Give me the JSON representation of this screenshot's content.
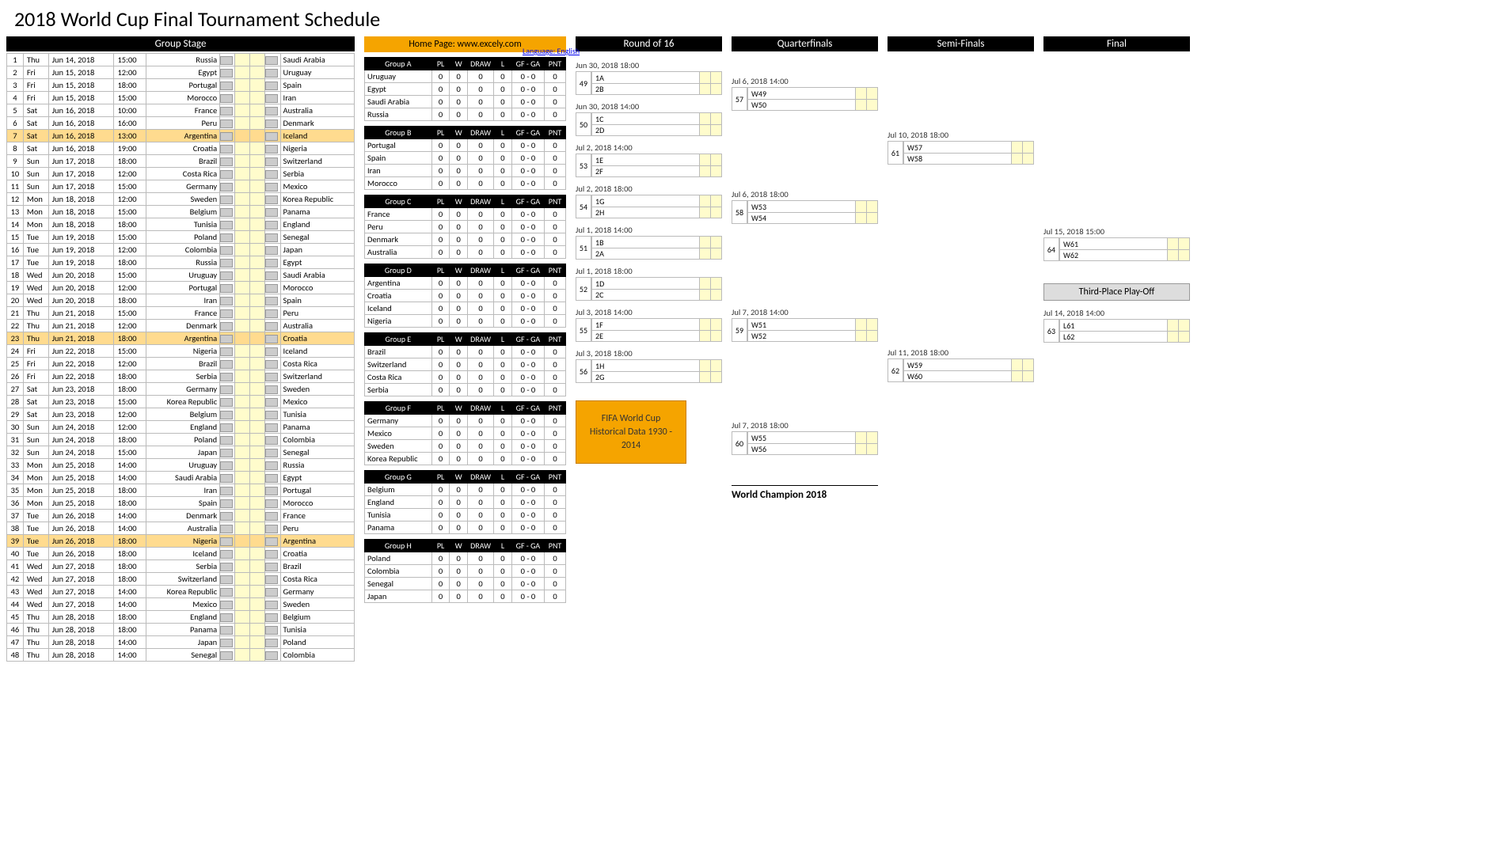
{
  "title": "2018 World Cup Final Tournament Schedule",
  "lang": "Language: English",
  "home": "Home Page: www.excely.com",
  "headers": {
    "group_stage": "Group Stage",
    "r16": "Round of 16",
    "qf": "Quarterfinals",
    "sf": "Semi-Finals",
    "final": "Final",
    "third": "Third-Place Play-Off",
    "champion": "World Champion 2018"
  },
  "gcols": {
    "pl": "PL",
    "w": "W",
    "draw": "DRAW",
    "l": "L",
    "gfga": "GF - GA",
    "pnt": "PNT"
  },
  "sched": [
    {
      "n": 1,
      "d": "Thu",
      "dt": "Jun 14, 2018",
      "t": "15:00",
      "h": "Russia",
      "a": "Saudi Arabia"
    },
    {
      "n": 2,
      "d": "Fri",
      "dt": "Jun 15, 2018",
      "t": "12:00",
      "h": "Egypt",
      "a": "Uruguay"
    },
    {
      "n": 3,
      "d": "Fri",
      "dt": "Jun 15, 2018",
      "t": "18:00",
      "h": "Portugal",
      "a": "Spain"
    },
    {
      "n": 4,
      "d": "Fri",
      "dt": "Jun 15, 2018",
      "t": "15:00",
      "h": "Morocco",
      "a": "Iran"
    },
    {
      "n": 5,
      "d": "Sat",
      "dt": "Jun 16, 2018",
      "t": "10:00",
      "h": "France",
      "a": "Australia"
    },
    {
      "n": 6,
      "d": "Sat",
      "dt": "Jun 16, 2018",
      "t": "16:00",
      "h": "Peru",
      "a": "Denmark"
    },
    {
      "n": 7,
      "d": "Sat",
      "dt": "Jun 16, 2018",
      "t": "13:00",
      "h": "Argentina",
      "a": "Iceland",
      "hl": true
    },
    {
      "n": 8,
      "d": "Sat",
      "dt": "Jun 16, 2018",
      "t": "19:00",
      "h": "Croatia",
      "a": "Nigeria"
    },
    {
      "n": 9,
      "d": "Sun",
      "dt": "Jun 17, 2018",
      "t": "18:00",
      "h": "Brazil",
      "a": "Switzerland"
    },
    {
      "n": 10,
      "d": "Sun",
      "dt": "Jun 17, 2018",
      "t": "12:00",
      "h": "Costa Rica",
      "a": "Serbia"
    },
    {
      "n": 11,
      "d": "Sun",
      "dt": "Jun 17, 2018",
      "t": "15:00",
      "h": "Germany",
      "a": "Mexico"
    },
    {
      "n": 12,
      "d": "Mon",
      "dt": "Jun 18, 2018",
      "t": "12:00",
      "h": "Sweden",
      "a": "Korea Republic"
    },
    {
      "n": 13,
      "d": "Mon",
      "dt": "Jun 18, 2018",
      "t": "15:00",
      "h": "Belgium",
      "a": "Panama"
    },
    {
      "n": 14,
      "d": "Mon",
      "dt": "Jun 18, 2018",
      "t": "18:00",
      "h": "Tunisia",
      "a": "England"
    },
    {
      "n": 15,
      "d": "Tue",
      "dt": "Jun 19, 2018",
      "t": "15:00",
      "h": "Poland",
      "a": "Senegal"
    },
    {
      "n": 16,
      "d": "Tue",
      "dt": "Jun 19, 2018",
      "t": "12:00",
      "h": "Colombia",
      "a": "Japan"
    },
    {
      "n": 17,
      "d": "Tue",
      "dt": "Jun 19, 2018",
      "t": "18:00",
      "h": "Russia",
      "a": "Egypt"
    },
    {
      "n": 18,
      "d": "Wed",
      "dt": "Jun 20, 2018",
      "t": "15:00",
      "h": "Uruguay",
      "a": "Saudi Arabia"
    },
    {
      "n": 19,
      "d": "Wed",
      "dt": "Jun 20, 2018",
      "t": "12:00",
      "h": "Portugal",
      "a": "Morocco"
    },
    {
      "n": 20,
      "d": "Wed",
      "dt": "Jun 20, 2018",
      "t": "18:00",
      "h": "Iran",
      "a": "Spain"
    },
    {
      "n": 21,
      "d": "Thu",
      "dt": "Jun 21, 2018",
      "t": "15:00",
      "h": "France",
      "a": "Peru"
    },
    {
      "n": 22,
      "d": "Thu",
      "dt": "Jun 21, 2018",
      "t": "12:00",
      "h": "Denmark",
      "a": "Australia"
    },
    {
      "n": 23,
      "d": "Thu",
      "dt": "Jun 21, 2018",
      "t": "18:00",
      "h": "Argentina",
      "a": "Croatia",
      "hl": true
    },
    {
      "n": 24,
      "d": "Fri",
      "dt": "Jun 22, 2018",
      "t": "15:00",
      "h": "Nigeria",
      "a": "Iceland"
    },
    {
      "n": 25,
      "d": "Fri",
      "dt": "Jun 22, 2018",
      "t": "12:00",
      "h": "Brazil",
      "a": "Costa Rica"
    },
    {
      "n": 26,
      "d": "Fri",
      "dt": "Jun 22, 2018",
      "t": "18:00",
      "h": "Serbia",
      "a": "Switzerland"
    },
    {
      "n": 27,
      "d": "Sat",
      "dt": "Jun 23, 2018",
      "t": "18:00",
      "h": "Germany",
      "a": "Sweden"
    },
    {
      "n": 28,
      "d": "Sat",
      "dt": "Jun 23, 2018",
      "t": "15:00",
      "h": "Korea Republic",
      "a": "Mexico"
    },
    {
      "n": 29,
      "d": "Sat",
      "dt": "Jun 23, 2018",
      "t": "12:00",
      "h": "Belgium",
      "a": "Tunisia"
    },
    {
      "n": 30,
      "d": "Sun",
      "dt": "Jun 24, 2018",
      "t": "12:00",
      "h": "England",
      "a": "Panama"
    },
    {
      "n": 31,
      "d": "Sun",
      "dt": "Jun 24, 2018",
      "t": "18:00",
      "h": "Poland",
      "a": "Colombia"
    },
    {
      "n": 32,
      "d": "Sun",
      "dt": "Jun 24, 2018",
      "t": "15:00",
      "h": "Japan",
      "a": "Senegal"
    },
    {
      "n": 33,
      "d": "Mon",
      "dt": "Jun 25, 2018",
      "t": "14:00",
      "h": "Uruguay",
      "a": "Russia"
    },
    {
      "n": 34,
      "d": "Mon",
      "dt": "Jun 25, 2018",
      "t": "14:00",
      "h": "Saudi Arabia",
      "a": "Egypt"
    },
    {
      "n": 35,
      "d": "Mon",
      "dt": "Jun 25, 2018",
      "t": "18:00",
      "h": "Iran",
      "a": "Portugal"
    },
    {
      "n": 36,
      "d": "Mon",
      "dt": "Jun 25, 2018",
      "t": "18:00",
      "h": "Spain",
      "a": "Morocco"
    },
    {
      "n": 37,
      "d": "Tue",
      "dt": "Jun 26, 2018",
      "t": "14:00",
      "h": "Denmark",
      "a": "France"
    },
    {
      "n": 38,
      "d": "Tue",
      "dt": "Jun 26, 2018",
      "t": "14:00",
      "h": "Australia",
      "a": "Peru"
    },
    {
      "n": 39,
      "d": "Tue",
      "dt": "Jun 26, 2018",
      "t": "18:00",
      "h": "Nigeria",
      "a": "Argentina",
      "hl": true
    },
    {
      "n": 40,
      "d": "Tue",
      "dt": "Jun 26, 2018",
      "t": "18:00",
      "h": "Iceland",
      "a": "Croatia"
    },
    {
      "n": 41,
      "d": "Wed",
      "dt": "Jun 27, 2018",
      "t": "18:00",
      "h": "Serbia",
      "a": "Brazil"
    },
    {
      "n": 42,
      "d": "Wed",
      "dt": "Jun 27, 2018",
      "t": "18:00",
      "h": "Switzerland",
      "a": "Costa Rica"
    },
    {
      "n": 43,
      "d": "Wed",
      "dt": "Jun 27, 2018",
      "t": "14:00",
      "h": "Korea Republic",
      "a": "Germany"
    },
    {
      "n": 44,
      "d": "Wed",
      "dt": "Jun 27, 2018",
      "t": "14:00",
      "h": "Mexico",
      "a": "Sweden"
    },
    {
      "n": 45,
      "d": "Thu",
      "dt": "Jun 28, 2018",
      "t": "18:00",
      "h": "England",
      "a": "Belgium"
    },
    {
      "n": 46,
      "d": "Thu",
      "dt": "Jun 28, 2018",
      "t": "18:00",
      "h": "Panama",
      "a": "Tunisia"
    },
    {
      "n": 47,
      "d": "Thu",
      "dt": "Jun 28, 2018",
      "t": "14:00",
      "h": "Japan",
      "a": "Poland"
    },
    {
      "n": 48,
      "d": "Thu",
      "dt": "Jun 28, 2018",
      "t": "14:00",
      "h": "Senegal",
      "a": "Colombia"
    }
  ],
  "groups": [
    {
      "name": "Group A",
      "teams": [
        "Uruguay",
        "Egypt",
        "Saudi Arabia",
        "Russia"
      ]
    },
    {
      "name": "Group B",
      "teams": [
        "Portugal",
        "Spain",
        "Iran",
        "Morocco"
      ]
    },
    {
      "name": "Group C",
      "teams": [
        "France",
        "Peru",
        "Denmark",
        "Australia"
      ]
    },
    {
      "name": "Group D",
      "teams": [
        "Argentina",
        "Croatia",
        "Iceland",
        "Nigeria"
      ]
    },
    {
      "name": "Group E",
      "teams": [
        "Brazil",
        "Switzerland",
        "Costa Rica",
        "Serbia"
      ]
    },
    {
      "name": "Group F",
      "teams": [
        "Germany",
        "Mexico",
        "Sweden",
        "Korea Republic"
      ]
    },
    {
      "name": "Group G",
      "teams": [
        "Belgium",
        "England",
        "Tunisia",
        "Panama"
      ]
    },
    {
      "name": "Group H",
      "teams": [
        "Poland",
        "Colombia",
        "Senegal",
        "Japan"
      ]
    }
  ],
  "zero": "0",
  "gfga0": "0 - 0",
  "r16": [
    {
      "n": 49,
      "dt": "Jun 30, 2018   18:00",
      "a": "1A",
      "b": "2B"
    },
    {
      "n": 50,
      "dt": "Jun 30, 2018   14:00",
      "a": "1C",
      "b": "2D"
    },
    {
      "n": 53,
      "dt": "Jul 2, 2018   14:00",
      "a": "1E",
      "b": "2F"
    },
    {
      "n": 54,
      "dt": "Jul 2, 2018   18:00",
      "a": "1G",
      "b": "2H"
    },
    {
      "n": 51,
      "dt": "Jul 1, 2018   14:00",
      "a": "1B",
      "b": "2A"
    },
    {
      "n": 52,
      "dt": "Jul 1, 2018   18:00",
      "a": "1D",
      "b": "2C"
    },
    {
      "n": 55,
      "dt": "Jul 3, 2018   14:00",
      "a": "1F",
      "b": "2E"
    },
    {
      "n": 56,
      "dt": "Jul 3, 2018   18:00",
      "a": "1H",
      "b": "2G"
    }
  ],
  "qf": [
    {
      "n": 57,
      "dt": "Jul 6, 2018   14:00",
      "a": "W49",
      "b": "W50"
    },
    {
      "n": 58,
      "dt": "Jul 6, 2018   18:00",
      "a": "W53",
      "b": "W54"
    },
    {
      "n": 59,
      "dt": "Jul 7, 2018   14:00",
      "a": "W51",
      "b": "W52"
    },
    {
      "n": 60,
      "dt": "Jul 7, 2018   18:00",
      "a": "W55",
      "b": "W56"
    }
  ],
  "sf": [
    {
      "n": 61,
      "dt": "Jul 10, 2018   18:00",
      "a": "W57",
      "b": "W58"
    },
    {
      "n": 62,
      "dt": "Jul 11, 2018   18:00",
      "a": "W59",
      "b": "W60"
    }
  ],
  "final": {
    "n": 64,
    "dt": "Jul 15, 2018   15:00",
    "a": "W61",
    "b": "W62"
  },
  "third": {
    "n": 63,
    "dt": "Jul 14, 2018   14:00",
    "a": "L61",
    "b": "L62"
  },
  "hist": "FIFA World Cup Historical Data 1930 - 2014"
}
